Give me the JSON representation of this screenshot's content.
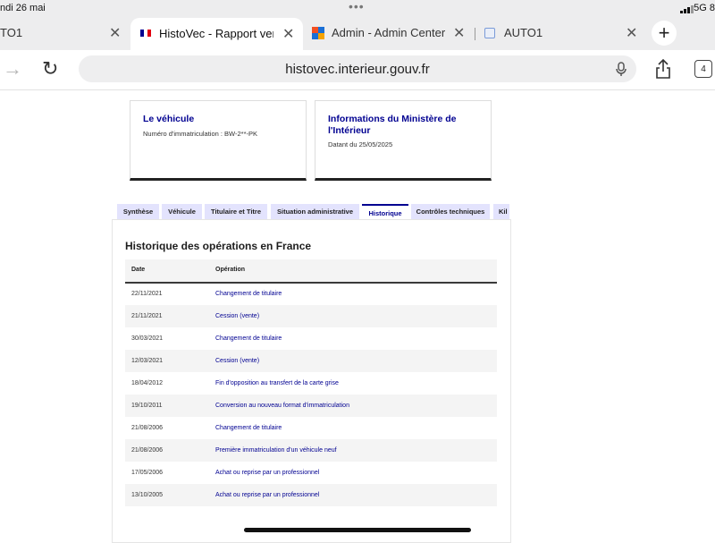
{
  "status": {
    "time": "ndi 26 mai",
    "network": "5G 8"
  },
  "tabs": [
    {
      "title": "TO1"
    },
    {
      "title": "HistoVec - Rapport vend"
    },
    {
      "title": "Admin - Admin Center"
    },
    {
      "title": "AUTO1"
    }
  ],
  "toolbar": {
    "url": "histovec.interieur.gouv.fr",
    "tab_count": "4"
  },
  "cards": {
    "vehicle": {
      "title": "Le véhicule",
      "line": "Numéro d'immatriculation : BW-2**-PK"
    },
    "ministry": {
      "title": "Informations du Ministère de l'Intérieur",
      "line": "Datant du 25/05/2025"
    }
  },
  "page_tabs": [
    "Synthèse",
    "Véhicule",
    "Titulaire et Titre",
    "Situation administrative",
    "Historique",
    "Contrôles techniques",
    "Kil"
  ],
  "history": {
    "title": "Historique des opérations en France",
    "col_date": "Date",
    "col_op": "Opération",
    "rows": [
      {
        "date": "22/11/2021",
        "op": "Changement de titulaire"
      },
      {
        "date": "21/11/2021",
        "op": "Cession (vente)"
      },
      {
        "date": "30/03/2021",
        "op": "Changement de titulaire"
      },
      {
        "date": "12/03/2021",
        "op": "Cession (vente)"
      },
      {
        "date": "18/04/2012",
        "op": "Fin d'opposition au transfert de la carte grise"
      },
      {
        "date": "19/10/2011",
        "op": "Conversion au nouveau format d'immatriculation"
      },
      {
        "date": "21/08/2006",
        "op": "Changement de titulaire"
      },
      {
        "date": "21/08/2006",
        "op": "Première immatriculation d'un véhicule neuf"
      },
      {
        "date": "17/05/2006",
        "op": "Achat ou reprise par un professionnel"
      },
      {
        "date": "13/10/2005",
        "op": "Achat ou reprise par un professionnel"
      }
    ]
  }
}
